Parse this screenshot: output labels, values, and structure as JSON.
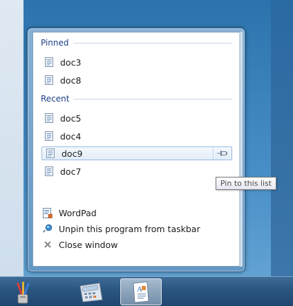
{
  "jumplist": {
    "pinned_header": "Pinned",
    "pinned_items": [
      {
        "label": "doc3"
      },
      {
        "label": "doc8"
      }
    ],
    "recent_header": "Recent",
    "recent_items": [
      {
        "label": "doc5"
      },
      {
        "label": "doc4"
      },
      {
        "label": "doc9",
        "state": "hover"
      },
      {
        "label": "doc7"
      }
    ],
    "tooltip": "Pin to this list",
    "tasks": [
      {
        "label": "WordPad",
        "icon": "wordpad-icon"
      },
      {
        "label": "Unpin this program from taskbar",
        "icon": "unpin-icon"
      },
      {
        "label": "Close window",
        "icon": "close-window-icon"
      }
    ]
  },
  "taskbar": {
    "buttons": [
      {
        "app": "paint",
        "icon": "paint-brushes-icon"
      },
      {
        "app": "calculator",
        "icon": "calculator-icon"
      },
      {
        "app": "wordpad",
        "icon": "wordpad-app-icon",
        "active": true
      }
    ]
  },
  "colors": {
    "section_header": "#1e3f87",
    "hover_border": "#9dbbe0",
    "taskbar": "#2b557f"
  }
}
